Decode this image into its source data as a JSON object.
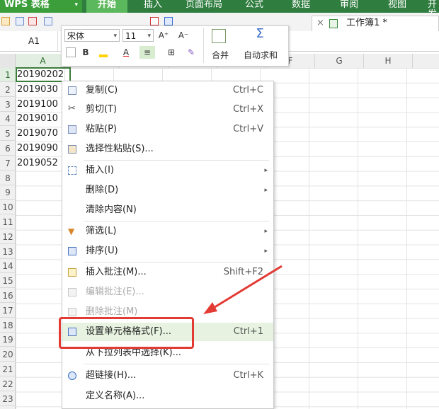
{
  "app": {
    "logo": "WPS 表格",
    "logo_dropdown": "▾"
  },
  "ribbon": {
    "tabs": [
      "开始",
      "插入",
      "页面布局",
      "公式",
      "数据",
      "审阅",
      "视图",
      "开发"
    ]
  },
  "document_tab": {
    "close": "×",
    "title": "工作簿1 *"
  },
  "name_box": {
    "value": "A1"
  },
  "columns": [
    "A",
    "",
    "",
    "",
    "",
    "F",
    "G",
    "H"
  ],
  "rows": [
    "1",
    "2",
    "3",
    "4",
    "5",
    "6",
    "7",
    "8",
    "9",
    "10",
    "11",
    "12",
    "13",
    "14",
    "15",
    "16",
    "17",
    "18",
    "19",
    "20",
    "21",
    "22",
    "23"
  ],
  "cells": [
    "20190202",
    "2019030",
    "2019100",
    "2019010",
    "2019070",
    "2019090",
    "2019052"
  ],
  "mini_toolbar": {
    "font": "宋体",
    "size": "11",
    "grow": "A⁺",
    "shrink": "A⁻",
    "bold": "B",
    "merge": "合并",
    "autosum_icon": "Σ",
    "autosum": "自动求和",
    "dropdown": "▾"
  },
  "context_menu": [
    {
      "label": "复制(C)",
      "shortcut": "Ctrl+C",
      "icon": "copy-icon"
    },
    {
      "label": "剪切(T)",
      "shortcut": "Ctrl+X",
      "icon": "scissors-icon"
    },
    {
      "label": "粘贴(P)",
      "shortcut": "Ctrl+V",
      "icon": "paste-icon"
    },
    {
      "label": "选择性粘贴(S)...",
      "shortcut": "",
      "icon": "paste-special-icon"
    },
    {
      "label": "插入(I)",
      "shortcut": "",
      "icon": "insert-icon",
      "submenu": true
    },
    {
      "label": "删除(D)",
      "shortcut": "",
      "icon": "",
      "submenu": true
    },
    {
      "label": "清除内容(N)",
      "shortcut": "",
      "icon": ""
    },
    {
      "label": "筛选(L)",
      "shortcut": "",
      "icon": "filter-icon",
      "submenu": true
    },
    {
      "label": "排序(U)",
      "shortcut": "",
      "icon": "sort-icon",
      "submenu": true
    },
    {
      "label": "插入批注(M)...",
      "shortcut": "Shift+F2",
      "icon": "comment-icon"
    },
    {
      "label": "编辑批注(E)...",
      "shortcut": "",
      "icon": "edit-comment-icon",
      "disabled": true
    },
    {
      "label": "删除批注(M)",
      "shortcut": "",
      "icon": "delete-comment-icon",
      "disabled": true
    },
    {
      "label": "设置单元格格式(F)...",
      "shortcut": "Ctrl+1",
      "icon": "format-cells-icon",
      "highlighted": true
    },
    {
      "label": "从下拉列表中选择(K)...",
      "shortcut": "",
      "icon": ""
    },
    {
      "label": "超链接(H)...",
      "shortcut": "Ctrl+K",
      "icon": "hyperlink-icon"
    },
    {
      "label": "定义名称(A)...",
      "shortcut": "",
      "icon": ""
    }
  ],
  "submenu_arrow": "▸",
  "colors": {
    "ribbon": "#2f7d3f",
    "active_tab": "#5cb85c",
    "highlight": "#e7f3e0",
    "annotation": "#e23b34"
  }
}
